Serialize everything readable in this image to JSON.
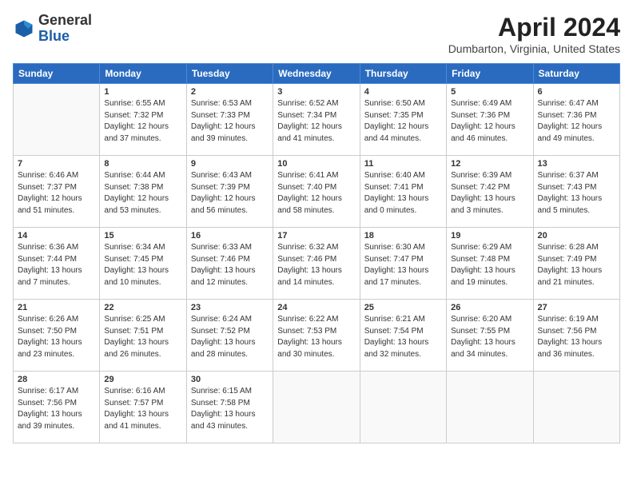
{
  "header": {
    "logo_general": "General",
    "logo_blue": "Blue",
    "month_title": "April 2024",
    "location": "Dumbarton, Virginia, United States"
  },
  "days_of_week": [
    "Sunday",
    "Monday",
    "Tuesday",
    "Wednesday",
    "Thursday",
    "Friday",
    "Saturday"
  ],
  "weeks": [
    [
      {
        "day": "",
        "info": ""
      },
      {
        "day": "1",
        "info": "Sunrise: 6:55 AM\nSunset: 7:32 PM\nDaylight: 12 hours\nand 37 minutes."
      },
      {
        "day": "2",
        "info": "Sunrise: 6:53 AM\nSunset: 7:33 PM\nDaylight: 12 hours\nand 39 minutes."
      },
      {
        "day": "3",
        "info": "Sunrise: 6:52 AM\nSunset: 7:34 PM\nDaylight: 12 hours\nand 41 minutes."
      },
      {
        "day": "4",
        "info": "Sunrise: 6:50 AM\nSunset: 7:35 PM\nDaylight: 12 hours\nand 44 minutes."
      },
      {
        "day": "5",
        "info": "Sunrise: 6:49 AM\nSunset: 7:36 PM\nDaylight: 12 hours\nand 46 minutes."
      },
      {
        "day": "6",
        "info": "Sunrise: 6:47 AM\nSunset: 7:36 PM\nDaylight: 12 hours\nand 49 minutes."
      }
    ],
    [
      {
        "day": "7",
        "info": "Sunrise: 6:46 AM\nSunset: 7:37 PM\nDaylight: 12 hours\nand 51 minutes."
      },
      {
        "day": "8",
        "info": "Sunrise: 6:44 AM\nSunset: 7:38 PM\nDaylight: 12 hours\nand 53 minutes."
      },
      {
        "day": "9",
        "info": "Sunrise: 6:43 AM\nSunset: 7:39 PM\nDaylight: 12 hours\nand 56 minutes."
      },
      {
        "day": "10",
        "info": "Sunrise: 6:41 AM\nSunset: 7:40 PM\nDaylight: 12 hours\nand 58 minutes."
      },
      {
        "day": "11",
        "info": "Sunrise: 6:40 AM\nSunset: 7:41 PM\nDaylight: 13 hours\nand 0 minutes."
      },
      {
        "day": "12",
        "info": "Sunrise: 6:39 AM\nSunset: 7:42 PM\nDaylight: 13 hours\nand 3 minutes."
      },
      {
        "day": "13",
        "info": "Sunrise: 6:37 AM\nSunset: 7:43 PM\nDaylight: 13 hours\nand 5 minutes."
      }
    ],
    [
      {
        "day": "14",
        "info": "Sunrise: 6:36 AM\nSunset: 7:44 PM\nDaylight: 13 hours\nand 7 minutes."
      },
      {
        "day": "15",
        "info": "Sunrise: 6:34 AM\nSunset: 7:45 PM\nDaylight: 13 hours\nand 10 minutes."
      },
      {
        "day": "16",
        "info": "Sunrise: 6:33 AM\nSunset: 7:46 PM\nDaylight: 13 hours\nand 12 minutes."
      },
      {
        "day": "17",
        "info": "Sunrise: 6:32 AM\nSunset: 7:46 PM\nDaylight: 13 hours\nand 14 minutes."
      },
      {
        "day": "18",
        "info": "Sunrise: 6:30 AM\nSunset: 7:47 PM\nDaylight: 13 hours\nand 17 minutes."
      },
      {
        "day": "19",
        "info": "Sunrise: 6:29 AM\nSunset: 7:48 PM\nDaylight: 13 hours\nand 19 minutes."
      },
      {
        "day": "20",
        "info": "Sunrise: 6:28 AM\nSunset: 7:49 PM\nDaylight: 13 hours\nand 21 minutes."
      }
    ],
    [
      {
        "day": "21",
        "info": "Sunrise: 6:26 AM\nSunset: 7:50 PM\nDaylight: 13 hours\nand 23 minutes."
      },
      {
        "day": "22",
        "info": "Sunrise: 6:25 AM\nSunset: 7:51 PM\nDaylight: 13 hours\nand 26 minutes."
      },
      {
        "day": "23",
        "info": "Sunrise: 6:24 AM\nSunset: 7:52 PM\nDaylight: 13 hours\nand 28 minutes."
      },
      {
        "day": "24",
        "info": "Sunrise: 6:22 AM\nSunset: 7:53 PM\nDaylight: 13 hours\nand 30 minutes."
      },
      {
        "day": "25",
        "info": "Sunrise: 6:21 AM\nSunset: 7:54 PM\nDaylight: 13 hours\nand 32 minutes."
      },
      {
        "day": "26",
        "info": "Sunrise: 6:20 AM\nSunset: 7:55 PM\nDaylight: 13 hours\nand 34 minutes."
      },
      {
        "day": "27",
        "info": "Sunrise: 6:19 AM\nSunset: 7:56 PM\nDaylight: 13 hours\nand 36 minutes."
      }
    ],
    [
      {
        "day": "28",
        "info": "Sunrise: 6:17 AM\nSunset: 7:56 PM\nDaylight: 13 hours\nand 39 minutes."
      },
      {
        "day": "29",
        "info": "Sunrise: 6:16 AM\nSunset: 7:57 PM\nDaylight: 13 hours\nand 41 minutes."
      },
      {
        "day": "30",
        "info": "Sunrise: 6:15 AM\nSunset: 7:58 PM\nDaylight: 13 hours\nand 43 minutes."
      },
      {
        "day": "",
        "info": ""
      },
      {
        "day": "",
        "info": ""
      },
      {
        "day": "",
        "info": ""
      },
      {
        "day": "",
        "info": ""
      }
    ]
  ]
}
